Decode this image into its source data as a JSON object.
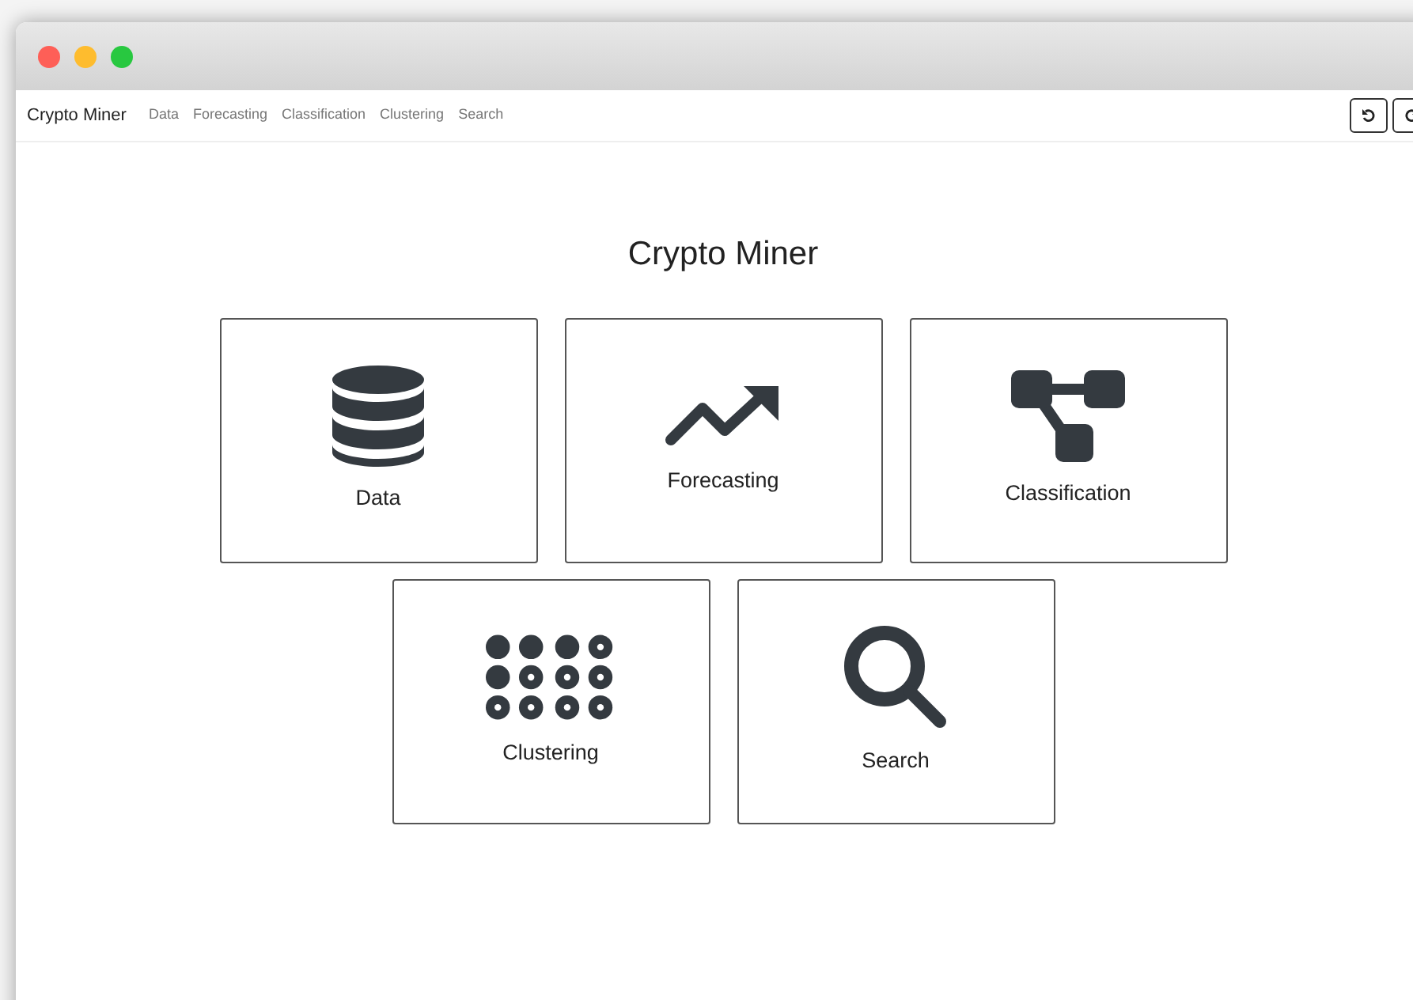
{
  "navbar": {
    "brand": "Crypto Miner",
    "links": [
      {
        "label": "Data"
      },
      {
        "label": "Forecasting"
      },
      {
        "label": "Classification"
      },
      {
        "label": "Clustering"
      },
      {
        "label": "Search"
      }
    ]
  },
  "heading": "Crypto Miner",
  "tiles": [
    {
      "label": "Data"
    },
    {
      "label": "Forecasting"
    },
    {
      "label": "Classification"
    },
    {
      "label": "Clustering"
    },
    {
      "label": "Search"
    }
  ]
}
